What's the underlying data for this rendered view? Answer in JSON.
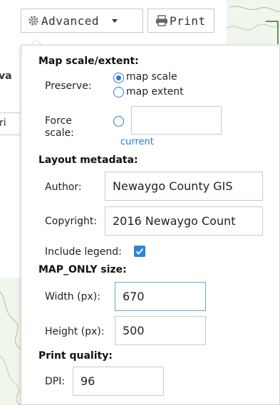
{
  "toolbar": {
    "advanced_label": "Advanced",
    "print_label": "Print"
  },
  "background": {
    "fragment_1": "va",
    "fragment_2": "ri"
  },
  "map_scale": {
    "heading": "Map scale/extent:",
    "preserve_label": "Preserve:",
    "option_scale": "map scale",
    "option_extent": "map extent",
    "selected": "map scale",
    "force_label_line1": "Force",
    "force_label_line2": "scale:",
    "force_value": "",
    "current_link": "current"
  },
  "layout": {
    "heading": "Layout metadata:",
    "author_label": "Author:",
    "author_value": "Newaygo County GIS",
    "copyright_label": "Copyright:",
    "copyright_value": "2016 Newaygo Count",
    "legend_label": "Include legend:",
    "legend_checked": true
  },
  "map_only": {
    "heading": "MAP_ONLY size:",
    "width_label": "Width (px):",
    "width_value": "670",
    "height_label": "Height (px):",
    "height_value": "500"
  },
  "quality": {
    "heading": "Print quality:",
    "dpi_label": "DPI:",
    "dpi_value": "96"
  },
  "colors": {
    "accent": "#2d7bd1",
    "map_bg": "#f1f6ec"
  }
}
